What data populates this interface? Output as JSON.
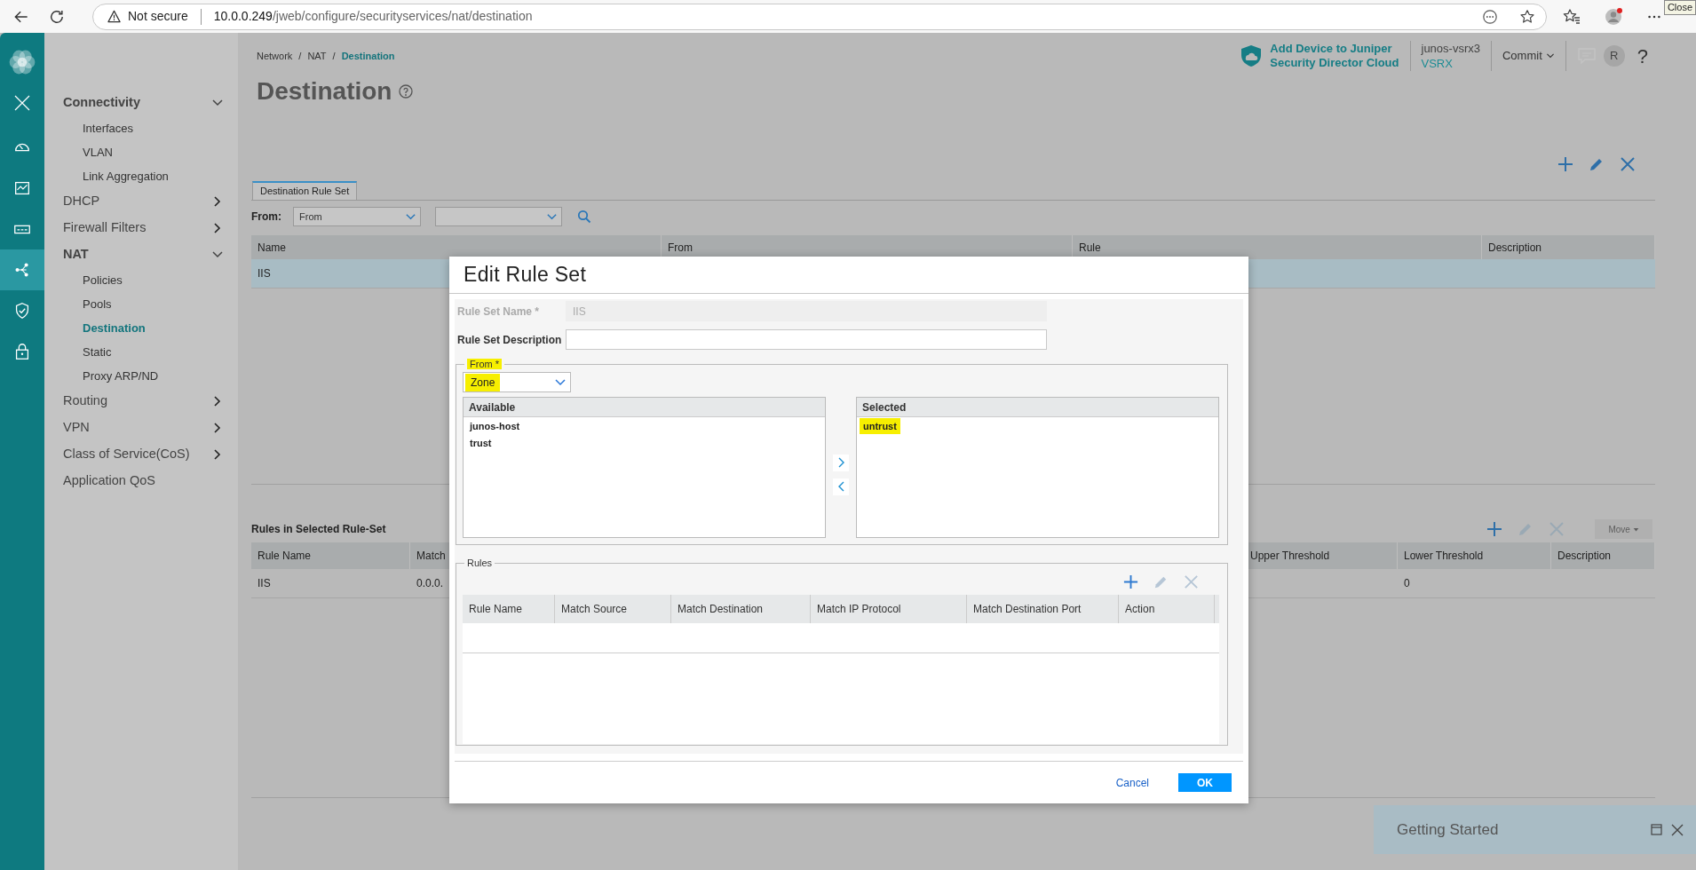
{
  "browser": {
    "security_label": "Not secure",
    "url_host": "10.0.0.249",
    "url_path": "/jweb/configure/securityservices/nat/destination",
    "tooltip": "Close"
  },
  "rail": {
    "items": [
      {
        "kind": "gauge",
        "selected": false
      },
      {
        "kind": "monitor",
        "selected": false
      },
      {
        "kind": "device",
        "selected": false
      },
      {
        "kind": "network",
        "selected": true
      },
      {
        "kind": "shield",
        "selected": false
      },
      {
        "kind": "lock",
        "selected": false
      }
    ]
  },
  "sidebar": {
    "items": [
      {
        "label": "Connectivity",
        "kind": "group",
        "expanded": true,
        "children": [
          {
            "label": "Interfaces",
            "selected": false
          },
          {
            "label": "VLAN",
            "selected": false
          },
          {
            "label": "Link Aggregation",
            "selected": false
          }
        ]
      },
      {
        "label": "DHCP",
        "kind": "group",
        "expanded": false
      },
      {
        "label": "Firewall Filters",
        "kind": "group",
        "expanded": false
      },
      {
        "label": "NAT",
        "kind": "group",
        "expanded": true,
        "children": [
          {
            "label": "Policies",
            "selected": false
          },
          {
            "label": "Pools",
            "selected": false
          },
          {
            "label": "Destination",
            "selected": true
          },
          {
            "label": "Static",
            "selected": false
          },
          {
            "label": "Proxy ARP/ND",
            "selected": false
          }
        ]
      },
      {
        "label": "Routing",
        "kind": "group",
        "expanded": false
      },
      {
        "label": "VPN",
        "kind": "group",
        "expanded": false
      },
      {
        "label": "Class of Service(CoS)",
        "kind": "group",
        "expanded": false
      },
      {
        "label": "Application QoS",
        "kind": "link"
      }
    ]
  },
  "header": {
    "breadcrumb": [
      {
        "label": "Network",
        "current": false
      },
      {
        "separator": "/",
        "label": "NAT",
        "current": false
      },
      {
        "separator": "/",
        "label": "Destination",
        "current": true
      }
    ],
    "title": "Destination",
    "cloud_link": [
      "Add Device to Juniper",
      "Security Director Cloud"
    ],
    "device": {
      "name": "junos-vsrx3",
      "model": "VSRX"
    },
    "commit": "Commit",
    "avatar": "R",
    "help": "?"
  },
  "rule_sets": {
    "toolbar": [
      {
        "kind": "add",
        "disabled": false
      },
      {
        "kind": "edit",
        "disabled": false
      },
      {
        "kind": "delete",
        "disabled": false
      }
    ],
    "tab": {
      "label": "Destination Rule Set",
      "selected": true
    },
    "filter": {
      "label": "From:",
      "value": "From"
    },
    "columns": [
      "Name",
      "From",
      "Rule",
      "Description"
    ],
    "rows": [
      {
        "name": "IIS",
        "selected": true
      }
    ]
  },
  "rules": {
    "title": "Rules in Selected Rule-Set",
    "toolbar": [
      {
        "kind": "add",
        "disabled": false
      },
      {
        "kind": "edit",
        "disabled": true
      },
      {
        "kind": "delete",
        "disabled": true
      }
    ],
    "move": {
      "label": "Move",
      "disabled": true
    },
    "columns": [
      "Rule Name",
      "Match",
      "Upper Threshold",
      "Lower Threshold",
      "Description"
    ],
    "rows": [
      {
        "rule_name": "IIS",
        "match": "0.0.0.",
        "lower_threshold": "0"
      }
    ]
  },
  "dialog": {
    "title": "Edit Rule Set",
    "fields": [
      {
        "label": "Rule Set Name *",
        "value": "IIS",
        "disabled": true
      },
      {
        "label": "Rule Set Description",
        "disabled": false
      }
    ],
    "from": {
      "legend": "From *",
      "highlighted": true,
      "select": {
        "value": "Zone",
        "highlighted": true
      },
      "available": {
        "title": "Available",
        "items": [
          {
            "label": "junos-host",
            "highlighted": false
          },
          {
            "label": "trust",
            "highlighted": false
          }
        ]
      },
      "selected": {
        "title": "Selected",
        "items": [
          {
            "label": "untrust",
            "highlighted": true
          }
        ]
      }
    },
    "rules": {
      "legend": "Rules",
      "toolbar": [
        {
          "kind": "add",
          "disabled": false
        },
        {
          "kind": "edit",
          "disabled": true
        },
        {
          "kind": "delete",
          "disabled": true
        }
      ],
      "columns": [
        "Rule Name",
        "Match Source",
        "Match Destination",
        "Match IP Protocol",
        "Match Destination Port",
        "Action"
      ]
    },
    "buttons": [
      {
        "label": "Cancel",
        "kind": "link"
      },
      {
        "label": "OK",
        "kind": "primary"
      }
    ]
  },
  "getting_started": {
    "title": "Getting Started"
  }
}
